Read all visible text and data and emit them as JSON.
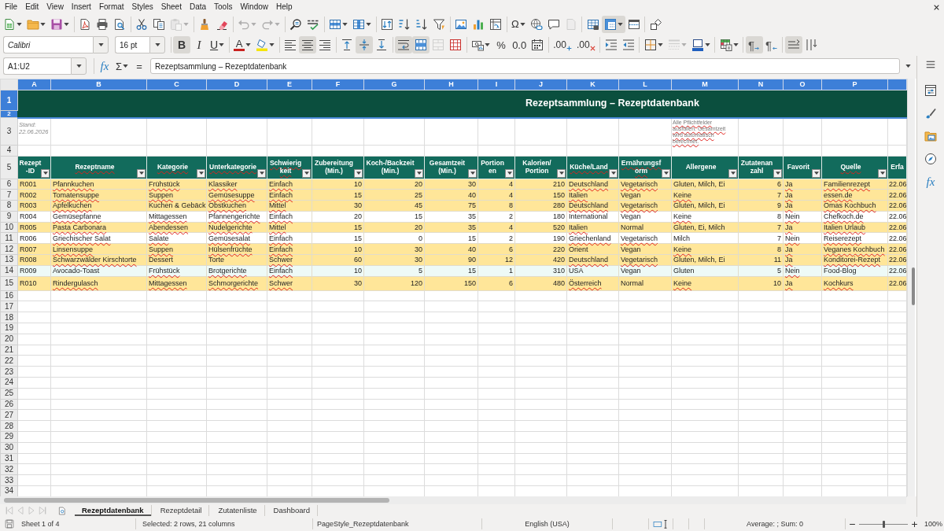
{
  "menu_bar": {
    "items": [
      "File",
      "Edit",
      "View",
      "Insert",
      "Format",
      "Styles",
      "Sheet",
      "Data",
      "Tools",
      "Window",
      "Help"
    ]
  },
  "standard_toolbar": [
    [
      {
        "pressed": false,
        "disabled": false,
        "dropdown": true
      },
      {
        "pressed": false,
        "disabled": false,
        "dropdown": true
      },
      {
        "pressed": false,
        "disabled": false,
        "dropdown": true
      }
    ],
    [
      {
        "pressed": false,
        "disabled": false,
        "dropdown": false
      },
      {
        "pressed": false,
        "disabled": false,
        "dropdown": false
      },
      {
        "pressed": false,
        "disabled": false,
        "dropdown": false
      }
    ],
    [
      {
        "pressed": false,
        "disabled": false,
        "dropdown": false
      },
      {
        "pressed": false,
        "disabled": false,
        "dropdown": false
      },
      {
        "pressed": false,
        "disabled": true,
        "dropdown": true
      }
    ],
    [
      {
        "pressed": false,
        "disabled": false,
        "dropdown": false
      },
      {
        "pressed": false,
        "disabled": false,
        "dropdown": false
      }
    ],
    [
      {
        "pressed": false,
        "disabled": true,
        "dropdown": true
      },
      {
        "pressed": false,
        "disabled": true,
        "dropdown": true
      }
    ],
    [
      {
        "pressed": false,
        "disabled": false,
        "dropdown": false
      },
      {
        "pressed": false,
        "disabled": false,
        "dropdown": false
      }
    ],
    [
      {
        "pressed": false,
        "disabled": false,
        "dropdown": true
      },
      {
        "pressed": false,
        "disabled": false,
        "dropdown": true
      }
    ],
    [
      {
        "pressed": false,
        "disabled": false,
        "dropdown": false
      },
      {
        "pressed": false,
        "disabled": false,
        "dropdown": false
      },
      {
        "pressed": false,
        "disabled": false,
        "dropdown": false
      },
      {
        "pressed": false,
        "disabled": false,
        "dropdown": false
      }
    ],
    [
      {
        "pressed": false,
        "disabled": false,
        "dropdown": false
      },
      {
        "pressed": false,
        "disabled": false,
        "dropdown": false
      },
      {
        "pressed": false,
        "disabled": false,
        "dropdown": false
      }
    ],
    [
      {
        "glyph": "Ω",
        "pressed": false,
        "disabled": false,
        "dropdown": true
      },
      {
        "pressed": false,
        "disabled": false,
        "dropdown": false
      },
      {
        "pressed": false,
        "disabled": false,
        "dropdown": false
      },
      {
        "pressed": false,
        "disabled": true,
        "dropdown": false
      }
    ],
    [
      {
        "pressed": false,
        "disabled": false,
        "dropdown": false
      },
      {
        "pressed": true,
        "disabled": false,
        "dropdown": true
      },
      {
        "pressed": false,
        "disabled": false,
        "dropdown": false
      }
    ],
    [
      {
        "pressed": false,
        "disabled": false,
        "dropdown": false
      }
    ]
  ],
  "formatting_toolbar": {
    "font_name": "Calibri",
    "font_size": "16 pt",
    "groups": [
      [
        {
          "glyph": "B",
          "pressed": true,
          "disabled": false,
          "dropdown": false
        },
        {
          "glyph": "I",
          "pressed": false,
          "disabled": false,
          "dropdown": false
        },
        {
          "glyph": "U",
          "pressed": false,
          "disabled": false,
          "dropdown": true
        }
      ],
      [
        {
          "glyph": "A",
          "pressed": false,
          "disabled": false,
          "dropdown": true
        },
        {
          "pressed": false,
          "disabled": false,
          "dropdown": true
        }
      ],
      [
        {
          "pressed": false,
          "disabled": false,
          "dropdown": false
        },
        {
          "pressed": true,
          "disabled": false,
          "dropdown": false
        },
        {
          "pressed": false,
          "disabled": false,
          "dropdown": false
        }
      ],
      [
        {
          "pressed": false,
          "disabled": false,
          "dropdown": false
        },
        {
          "pressed": true,
          "disabled": false,
          "dropdown": false
        },
        {
          "pressed": false,
          "disabled": false,
          "dropdown": false
        }
      ],
      [
        {
          "pressed": true,
          "disabled": false,
          "dropdown": false
        },
        {
          "pressed": true,
          "disabled": false,
          "dropdown": false
        },
        {
          "pressed": false,
          "disabled": true,
          "dropdown": false
        },
        {
          "pressed": false,
          "disabled": false,
          "dropdown": false
        }
      ],
      [
        {
          "pressed": false,
          "disabled": false,
          "dropdown": true
        },
        {
          "glyph": "%",
          "pressed": false,
          "disabled": false,
          "dropdown": false
        },
        {
          "glyph": "0.0",
          "pressed": false,
          "disabled": false,
          "dropdown": false
        },
        {
          "pressed": false,
          "disabled": false,
          "dropdown": false
        }
      ],
      [
        {
          "glyph": ".00",
          "pressed": false,
          "disabled": false,
          "dropdown": false
        },
        {
          "glyph": ".00",
          "pressed": false,
          "disabled": false,
          "dropdown": false
        }
      ],
      [
        {
          "pressed": false,
          "disabled": false,
          "dropdown": false
        },
        {
          "pressed": false,
          "disabled": false,
          "dropdown": false
        }
      ],
      [
        {
          "pressed": false,
          "disabled": false,
          "dropdown": true
        },
        {
          "pressed": false,
          "disabled": true,
          "dropdown": true
        },
        {
          "pressed": false,
          "disabled": false,
          "dropdown": true
        }
      ],
      [
        {
          "pressed": false,
          "disabled": false,
          "dropdown": true
        }
      ],
      [
        {
          "glyph": "¶",
          "pressed": true,
          "disabled": false,
          "dropdown": false
        },
        {
          "glyph": "¶",
          "pressed": false,
          "disabled": false,
          "dropdown": false
        }
      ],
      [
        {
          "pressed": true,
          "disabled": false,
          "dropdown": false
        },
        {
          "pressed": false,
          "disabled": false,
          "dropdown": false
        }
      ]
    ]
  },
  "formula_bar": {
    "name_box": "A1:U2",
    "function_wizard": "fx",
    "sum": "Σ",
    "formula": "=",
    "content": "Rezeptsammlung – Rezeptdatenbank"
  },
  "sheet": {
    "column_headers": [
      {
        "label": "A",
        "selected": true
      },
      {
        "label": "B",
        "selected": true
      },
      {
        "label": "C",
        "selected": true
      },
      {
        "label": "D",
        "selected": true
      },
      {
        "label": "E",
        "selected": true
      },
      {
        "label": "F",
        "selected": true
      },
      {
        "label": "G",
        "selected": true
      },
      {
        "label": "H",
        "selected": true
      },
      {
        "label": "I",
        "selected": true
      },
      {
        "label": "J",
        "selected": true
      },
      {
        "label": "K",
        "selected": true
      },
      {
        "label": "L",
        "selected": true
      },
      {
        "label": "M",
        "selected": true
      },
      {
        "label": "N",
        "selected": true
      },
      {
        "label": "O",
        "selected": true
      },
      {
        "label": "P",
        "selected": true
      }
    ],
    "row_headers": [
      {
        "label": "1",
        "selected": true
      },
      {
        "label": "2",
        "selected": true
      },
      {
        "label": "3",
        "selected": false
      },
      {
        "label": "4",
        "selected": false
      },
      {
        "label": "5",
        "selected": false
      },
      {
        "label": "6",
        "selected": false
      },
      {
        "label": "7",
        "selected": false
      },
      {
        "label": "8",
        "selected": false
      },
      {
        "label": "9",
        "selected": false
      },
      {
        "label": "10",
        "selected": false
      },
      {
        "label": "11",
        "selected": false
      },
      {
        "label": "12",
        "selected": false
      },
      {
        "label": "13",
        "selected": false
      },
      {
        "label": "14",
        "selected": false
      },
      {
        "label": "15",
        "selected": false
      },
      {
        "label": "16",
        "selected": false
      },
      {
        "label": "17",
        "selected": false
      },
      {
        "label": "18",
        "selected": false
      },
      {
        "label": "19",
        "selected": false
      },
      {
        "label": "20",
        "selected": false
      },
      {
        "label": "21",
        "selected": false
      },
      {
        "label": "22",
        "selected": false
      },
      {
        "label": "23",
        "selected": false
      },
      {
        "label": "24",
        "selected": false
      },
      {
        "label": "25",
        "selected": false
      },
      {
        "label": "26",
        "selected": false
      },
      {
        "label": "27",
        "selected": false
      },
      {
        "label": "28",
        "selected": false
      },
      {
        "label": "29",
        "selected": false
      },
      {
        "label": "30",
        "selected": false
      },
      {
        "label": "31",
        "selected": false
      },
      {
        "label": "32",
        "selected": false
      },
      {
        "label": "33",
        "selected": false
      },
      {
        "label": "34",
        "selected": false
      }
    ],
    "title": "Rezeptsammlung – Rezeptdatenbank",
    "date_note": "Stand: 22.06.2026",
    "hint": {
      "text": "Alle Pflichtfelder ausfüllen. Gesamtzeit wird automatisch berechnet.",
      "misspelled": true
    },
    "table_headers": [
      {
        "label": "Rezept-ID",
        "misspelled": false,
        "filter": true
      },
      {
        "label": "Rezeptname",
        "misspelled": true,
        "filter": true
      },
      {
        "label": "Kategorie",
        "misspelled": true,
        "filter": true
      },
      {
        "label": "Unterkategorie",
        "misspelled": true,
        "filter": true
      },
      {
        "label": "Schwierigkeit",
        "misspelled": true,
        "filter": true
      },
      {
        "label": "Zubereitung (Min.)",
        "misspelled": false,
        "filter": true
      },
      {
        "label": "Koch-/Backzeit (Min.)",
        "misspelled": false,
        "filter": true
      },
      {
        "label": "Gesamtzeit (Min.)",
        "misspelled": false,
        "filter": true
      },
      {
        "label": "Portionen",
        "misspelled": false,
        "filter": true
      },
      {
        "label": "Kalorien/ Portion",
        "misspelled": false,
        "filter": true
      },
      {
        "label": "Küche/Land",
        "misspelled": true,
        "filter": true
      },
      {
        "label": "Ernährungsform",
        "misspelled": true,
        "filter": true
      },
      {
        "label": "Allergene",
        "misspelled": false,
        "filter": true
      },
      {
        "label": "Zutatenanzahl",
        "misspelled": false,
        "filter": true
      },
      {
        "label": "Favorit",
        "misspelled": false,
        "filter": true
      },
      {
        "label": "Quelle",
        "misspelled": true,
        "filter": true
      },
      {
        "label": "Erfa",
        "filter": false
      }
    ],
    "rows": [
      {
        "color": "#ffe699",
        "cells": [
          {
            "text": "R001",
            "misspelled": false
          },
          {
            "text": "Pfannkuchen",
            "misspelled": true
          },
          {
            "text": "Frühstück",
            "misspelled": true
          },
          {
            "text": "Klassiker",
            "misspelled": true
          },
          {
            "text": "Einfach",
            "misspelled": true
          },
          {
            "text": "10"
          },
          {
            "text": "20"
          },
          {
            "text": "30"
          },
          {
            "text": "4"
          },
          {
            "text": "210"
          },
          {
            "text": "Deutschland",
            "misspelled": true
          },
          {
            "text": "Vegetarisch",
            "misspelled": true
          },
          {
            "text": "Gluten, Milch, Ei",
            "misspelled": false
          },
          {
            "text": "6"
          },
          {
            "text": "Ja",
            "misspelled": true
          },
          {
            "text": "Familienrezept",
            "misspelled": true
          },
          {
            "text": "22.06",
            "misspelled": false
          }
        ]
      },
      {
        "color": "#ffe699",
        "cells": [
          {
            "text": "R002",
            "misspelled": false
          },
          {
            "text": "Tomatensuppe",
            "misspelled": true
          },
          {
            "text": "Suppen",
            "misspelled": true
          },
          {
            "text": "Gemüsesuppe",
            "misspelled": true
          },
          {
            "text": "Einfach",
            "misspelled": true
          },
          {
            "text": "15"
          },
          {
            "text": "25"
          },
          {
            "text": "40"
          },
          {
            "text": "4"
          },
          {
            "text": "150"
          },
          {
            "text": "Italien",
            "misspelled": true
          },
          {
            "text": "Vegan",
            "misspelled": false
          },
          {
            "text": "Keine",
            "misspelled": true
          },
          {
            "text": "7"
          },
          {
            "text": "Ja",
            "misspelled": true
          },
          {
            "text": "essen.de",
            "misspelled": true
          },
          {
            "text": "22.06",
            "misspelled": false
          }
        ]
      },
      {
        "color": "#ffe699",
        "cells": [
          {
            "text": "R003",
            "misspelled": false
          },
          {
            "text": "Apfelkuchen",
            "misspelled": true
          },
          {
            "text": "Kuchen & Gebäck",
            "misspelled": false
          },
          {
            "text": "Obstkuchen",
            "misspelled": true
          },
          {
            "text": "Mittel",
            "misspelled": true
          },
          {
            "text": "30"
          },
          {
            "text": "45"
          },
          {
            "text": "75"
          },
          {
            "text": "8"
          },
          {
            "text": "280"
          },
          {
            "text": "Deutschland",
            "misspelled": true
          },
          {
            "text": "Vegetarisch",
            "misspelled": true
          },
          {
            "text": "Gluten, Milch, Ei",
            "misspelled": false
          },
          {
            "text": "9"
          },
          {
            "text": "Ja",
            "misspelled": true
          },
          {
            "text": "Omas Kochbuch",
            "misspelled": true
          },
          {
            "text": "22.06",
            "misspelled": false
          }
        ]
      },
      {
        "color": "#ffffff",
        "cells": [
          {
            "text": "R004",
            "misspelled": false
          },
          {
            "text": "Gemüsepfanne",
            "misspelled": true
          },
          {
            "text": "Mittagessen",
            "misspelled": true
          },
          {
            "text": "Pfannengerichte",
            "misspelled": true
          },
          {
            "text": "Einfach",
            "misspelled": true
          },
          {
            "text": "20"
          },
          {
            "text": "15"
          },
          {
            "text": "35"
          },
          {
            "text": "2"
          },
          {
            "text": "180"
          },
          {
            "text": "International",
            "misspelled": false
          },
          {
            "text": "Vegan",
            "misspelled": false
          },
          {
            "text": "Keine",
            "misspelled": true
          },
          {
            "text": "8"
          },
          {
            "text": "Nein",
            "misspelled": true
          },
          {
            "text": "Chefkoch.de",
            "misspelled": true
          },
          {
            "text": "22.06",
            "misspelled": false
          }
        ]
      },
      {
        "color": "#ffe699",
        "cells": [
          {
            "text": "R005",
            "misspelled": false
          },
          {
            "text": "Pasta Carbonara",
            "misspelled": true
          },
          {
            "text": "Abendessen",
            "misspelled": true
          },
          {
            "text": "Nudelgerichte",
            "misspelled": true
          },
          {
            "text": "Mittel",
            "misspelled": true
          },
          {
            "text": "15"
          },
          {
            "text": "20"
          },
          {
            "text": "35"
          },
          {
            "text": "4"
          },
          {
            "text": "520"
          },
          {
            "text": "Italien",
            "misspelled": true
          },
          {
            "text": "Normal",
            "misspelled": false
          },
          {
            "text": "Gluten, Ei, Milch",
            "misspelled": false
          },
          {
            "text": "7"
          },
          {
            "text": "Ja",
            "misspelled": true
          },
          {
            "text": "Italien Urlaub",
            "misspelled": true
          },
          {
            "text": "22.06",
            "misspelled": false
          }
        ]
      },
      {
        "color": "#ffffff",
        "cells": [
          {
            "text": "R006",
            "misspelled": false
          },
          {
            "text": "Griechischer Salat",
            "misspelled": true
          },
          {
            "text": "Salate",
            "misspelled": true
          },
          {
            "text": "Gemüsesalat",
            "misspelled": true
          },
          {
            "text": "Einfach",
            "misspelled": true
          },
          {
            "text": "15"
          },
          {
            "text": "0"
          },
          {
            "text": "15"
          },
          {
            "text": "2"
          },
          {
            "text": "190"
          },
          {
            "text": "Griechenland",
            "misspelled": true
          },
          {
            "text": "Vegetarisch",
            "misspelled": true
          },
          {
            "text": "Milch",
            "misspelled": false
          },
          {
            "text": "7"
          },
          {
            "text": "Nein",
            "misspelled": true
          },
          {
            "text": "Reiserezept",
            "misspelled": true
          },
          {
            "text": "22.06",
            "misspelled": false
          }
        ]
      },
      {
        "color": "#ffe699",
        "cells": [
          {
            "text": "R007",
            "misspelled": false
          },
          {
            "text": "Linsensuppe",
            "misspelled": true
          },
          {
            "text": "Suppen",
            "misspelled": true
          },
          {
            "text": "Hülsenfrüchte",
            "misspelled": true
          },
          {
            "text": "Einfach",
            "misspelled": true
          },
          {
            "text": "10"
          },
          {
            "text": "30"
          },
          {
            "text": "40"
          },
          {
            "text": "6"
          },
          {
            "text": "220"
          },
          {
            "text": "Orient",
            "misspelled": false
          },
          {
            "text": "Vegan",
            "misspelled": false
          },
          {
            "text": "Keine",
            "misspelled": true
          },
          {
            "text": "8"
          },
          {
            "text": "Ja",
            "misspelled": true
          },
          {
            "text": "Veganes Kochbuch",
            "misspelled": true
          },
          {
            "text": "22.06",
            "misspelled": false
          }
        ]
      },
      {
        "color": "#ffe699",
        "cells": [
          {
            "text": "R008",
            "misspelled": false
          },
          {
            "text": "Schwarzwälder Kirschtorte",
            "misspelled": true
          },
          {
            "text": "Dessert",
            "misspelled": false
          },
          {
            "text": "Torte",
            "misspelled": false
          },
          {
            "text": "Schwer",
            "misspelled": true
          },
          {
            "text": "60"
          },
          {
            "text": "30"
          },
          {
            "text": "90"
          },
          {
            "text": "12"
          },
          {
            "text": "420"
          },
          {
            "text": "Deutschland",
            "misspelled": true
          },
          {
            "text": "Vegetarisch",
            "misspelled": true
          },
          {
            "text": "Gluten, Milch, Ei",
            "misspelled": false
          },
          {
            "text": "11"
          },
          {
            "text": "Ja",
            "misspelled": true
          },
          {
            "text": "Konditorei-Rezept",
            "misspelled": true
          },
          {
            "text": "22.06",
            "misspelled": false
          }
        ]
      },
      {
        "color": "#eefaf7",
        "cells": [
          {
            "text": "R009",
            "misspelled": false
          },
          {
            "text": "Avocado-Toast",
            "misspelled": false
          },
          {
            "text": "Frühstück",
            "misspelled": true
          },
          {
            "text": "Brotgerichte",
            "misspelled": true
          },
          {
            "text": "Einfach",
            "misspelled": true
          },
          {
            "text": "10"
          },
          {
            "text": "5"
          },
          {
            "text": "15"
          },
          {
            "text": "1"
          },
          {
            "text": "310"
          },
          {
            "text": "USA",
            "misspelled": false
          },
          {
            "text": "Vegan",
            "misspelled": false
          },
          {
            "text": "Gluten",
            "misspelled": false
          },
          {
            "text": "5"
          },
          {
            "text": "Nein",
            "misspelled": true
          },
          {
            "text": "Food-Blog",
            "misspelled": false
          },
          {
            "text": "22.06",
            "misspelled": false
          }
        ]
      },
      {
        "color": "#ffe699",
        "cells": [
          {
            "text": "R010",
            "misspelled": false
          },
          {
            "text": "Rindergulasch",
            "misspelled": true
          },
          {
            "text": "Mittagessen",
            "misspelled": true
          },
          {
            "text": "Schmorgerichte",
            "misspelled": true
          },
          {
            "text": "Schwer",
            "misspelled": true
          },
          {
            "text": "30"
          },
          {
            "text": "120"
          },
          {
            "text": "150"
          },
          {
            "text": "6"
          },
          {
            "text": "480"
          },
          {
            "text": "Österreich",
            "misspelled": true
          },
          {
            "text": "Normal",
            "misspelled": false
          },
          {
            "text": "Keine",
            "misspelled": true
          },
          {
            "text": "10"
          },
          {
            "text": "Ja",
            "misspelled": true
          },
          {
            "text": "Kochkurs",
            "misspelled": true
          },
          {
            "text": "22.06",
            "misspelled": false
          }
        ]
      }
    ]
  },
  "sidebar": {
    "functions": "fx"
  },
  "sheet_tabs": [
    {
      "label": "Rezeptdatenbank",
      "selected": true
    },
    {
      "label": "Rezeptdetail",
      "selected": false
    },
    {
      "label": "Zutatenliste",
      "selected": false
    },
    {
      "label": "Dashboard",
      "selected": false
    }
  ],
  "status_bar": {
    "sheet": "Sheet 1 of 4",
    "selection": "Selected: 2 rows, 21 columns",
    "page_style": "PageStyle_Rezeptdatenbank",
    "language": "English (USA)",
    "summary": "Average: ; Sum: 0",
    "zoom": {
      "level": 0.5,
      "value": "100%"
    }
  }
}
